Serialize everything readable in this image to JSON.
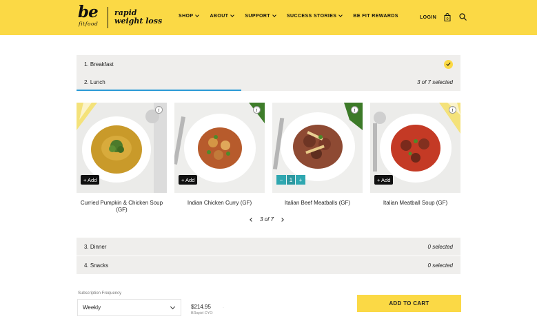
{
  "brand": {
    "logo_main": "be",
    "logo_sub": "fitfood",
    "tagline_line1": "rapid",
    "tagline_line2": "weight loss"
  },
  "nav": {
    "items": [
      {
        "label": "SHOP",
        "has_dropdown": true
      },
      {
        "label": "ABOUT",
        "has_dropdown": true
      },
      {
        "label": "SUPPORT",
        "has_dropdown": true
      },
      {
        "label": "SUCCESS STORIES",
        "has_dropdown": true
      },
      {
        "label": "BE FIT REWARDS",
        "has_dropdown": false
      }
    ],
    "login_label": "LOGIN",
    "cart_count": "0"
  },
  "meal_sections": [
    {
      "label": "1. Breakfast",
      "status": "",
      "completed": true
    },
    {
      "label": "2. Lunch",
      "status": "3 of 7 selected",
      "active": true
    },
    {
      "label": "3. Dinner",
      "status": "0 selected"
    },
    {
      "label": "4. Snacks",
      "status": "0 selected"
    }
  ],
  "products": [
    {
      "name": "Curried Pumpkin & Chicken Soup (GF)",
      "add_label": "+ Add",
      "info_label": "i"
    },
    {
      "name": "Indian Chicken Curry (GF)",
      "add_label": "+ Add",
      "info_label": "i"
    },
    {
      "name": "Italian Beef Meatballs (GF)",
      "qty": "1",
      "minus": "−",
      "plus": "+",
      "info_label": "i"
    },
    {
      "name": "Italian Meatball Soup (GF)",
      "add_label": "+ Add",
      "info_label": "i"
    }
  ],
  "pager": {
    "label": "3 of 7"
  },
  "subscription": {
    "label": "Subscription Frequency",
    "value": "Weekly",
    "price": "$214.95",
    "price_sub": "BRapid CYO",
    "dot": "·",
    "add_to_cart_label": "ADD TO CART"
  },
  "colors": {
    "accent_yellow": "#fbd945",
    "tab_underline": "#2a9ad6",
    "stepper_teal": "#2fa7b0"
  }
}
